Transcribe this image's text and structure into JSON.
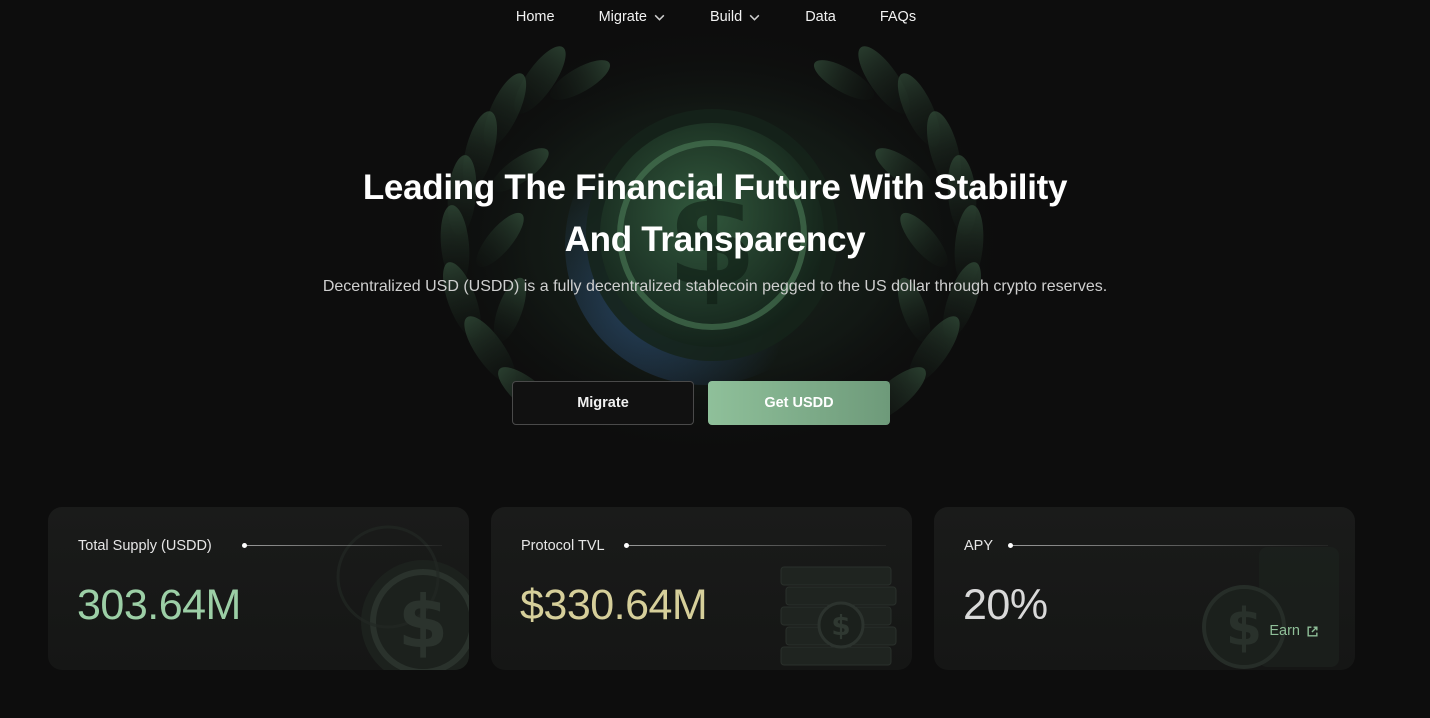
{
  "nav": {
    "items": [
      {
        "label": "Home",
        "has_dropdown": false
      },
      {
        "label": "Migrate",
        "has_dropdown": true
      },
      {
        "label": "Build",
        "has_dropdown": true
      },
      {
        "label": "Data",
        "has_dropdown": false
      },
      {
        "label": "FAQs",
        "has_dropdown": false
      }
    ]
  },
  "hero": {
    "title_line1": "Leading The Financial Future With Stability",
    "title_line2": "And Transparency",
    "subtitle": "Decentralized USD (USDD) is a fully decentralized stablecoin pegged to the US dollar through crypto reserves.",
    "buttons": {
      "migrate_label": "Migrate",
      "get_usdd_label": "Get USDD"
    }
  },
  "stats": {
    "total_supply": {
      "label": "Total Supply (USDD)",
      "value": "303.64M"
    },
    "protocol_tvl": {
      "label": "Protocol TVL",
      "value": "$330.64M"
    },
    "apy": {
      "label": "APY",
      "value": "20%",
      "link_label": "Earn"
    }
  },
  "colors": {
    "background": "#0d0d0d",
    "accent_green": "#8fc09a",
    "supply_value": "#9ccfa6",
    "tvl_value": "#d6cf9a",
    "apy_value": "#d9d9d9"
  },
  "icons": [
    "chevron-down-icon",
    "external-link-icon",
    "dollar-coin-icon",
    "laurel-wreath-icon"
  ]
}
